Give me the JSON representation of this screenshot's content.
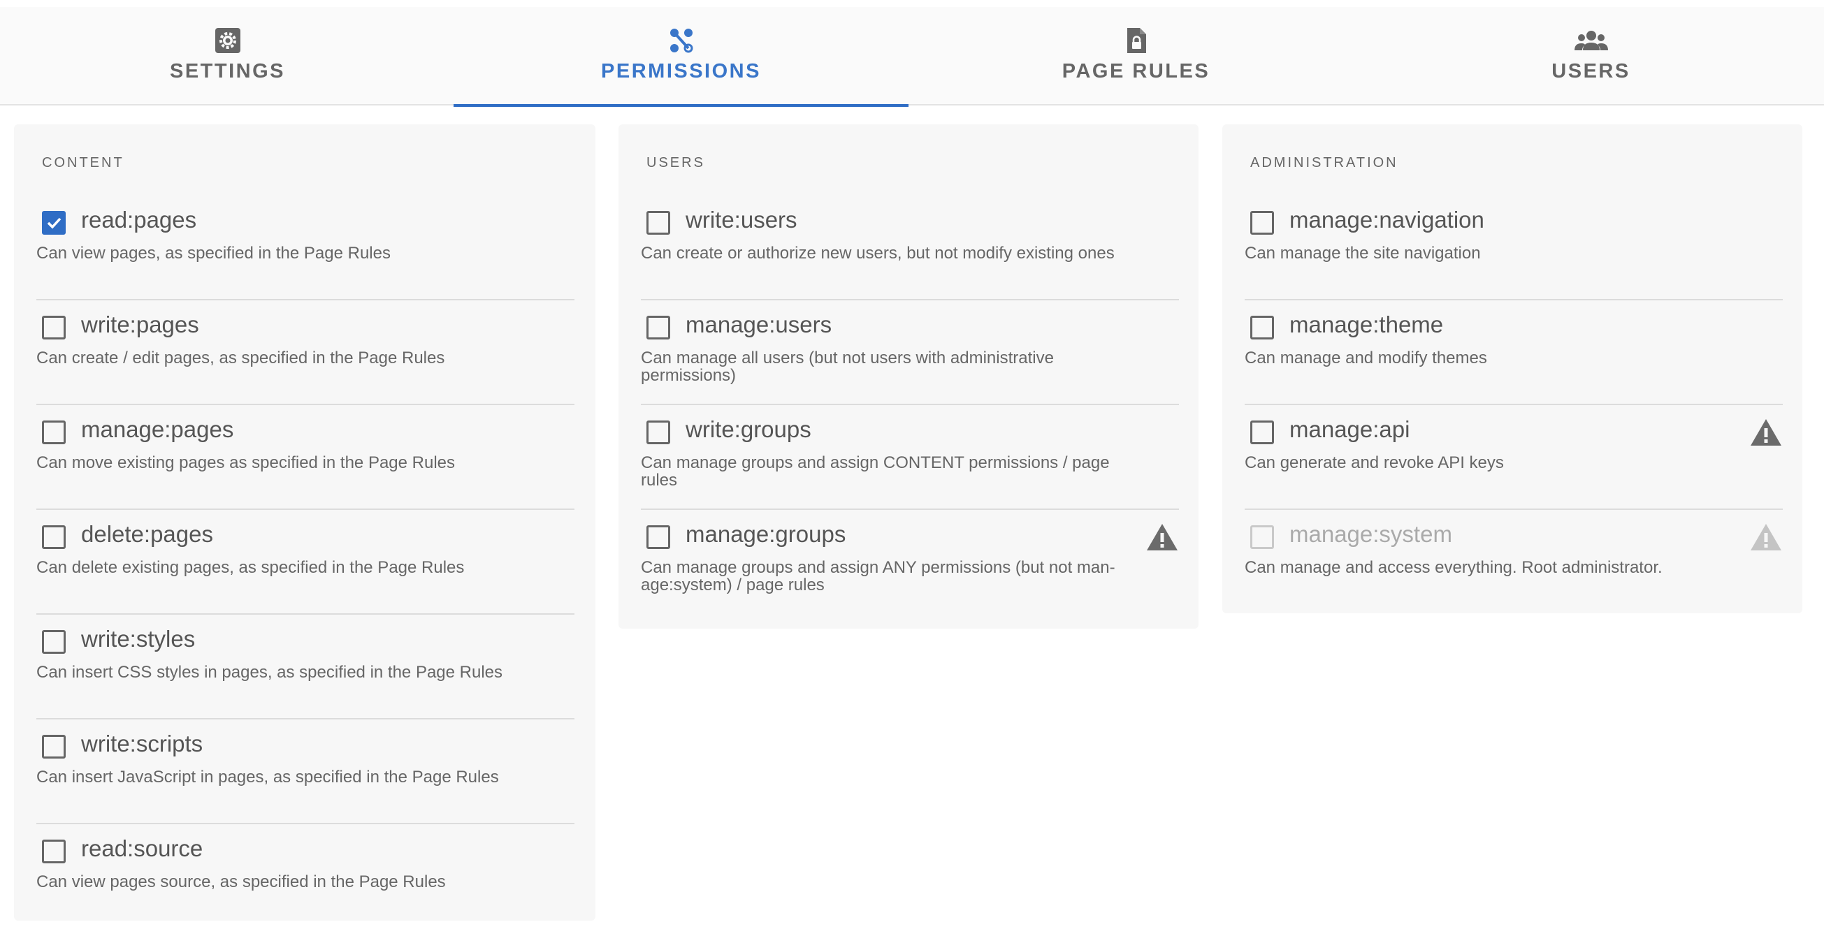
{
  "tabs": [
    {
      "label": "SETTINGS",
      "icon": "gear-icon",
      "active": false
    },
    {
      "label": "PERMISSIONS",
      "icon": "permissions-icon",
      "active": true
    },
    {
      "label": "PAGE RULES",
      "icon": "locked-file-icon",
      "active": false
    },
    {
      "label": "USERS",
      "icon": "users-icon",
      "active": false
    }
  ],
  "colors": {
    "accent": "#2f6dc5",
    "card_bg": "#f7f7f7",
    "warn": "#6b6b6b",
    "warn_disabled": "#c4c4c4"
  },
  "groups": [
    {
      "title": "CONTENT",
      "items": [
        {
          "name": "read:pages",
          "desc": "Can view pages, as specified in the Page Rules",
          "checked": true
        },
        {
          "name": "write:pages",
          "desc": "Can create / edit pages, as specified in the Page Rules",
          "checked": false
        },
        {
          "name": "manage:pages",
          "desc": "Can move existing pages as specified in the Page Rules",
          "checked": false
        },
        {
          "name": "delete:pages",
          "desc": "Can delete existing pages, as specified in the Page Rules",
          "checked": false
        },
        {
          "name": "write:styles",
          "desc": "Can insert CSS styles in pages, as specified in the Page Rules",
          "checked": false
        },
        {
          "name": "write:scripts",
          "desc": "Can insert JavaScript in pages, as specified in the Page Rules",
          "checked": false
        },
        {
          "name": "read:source",
          "desc": "Can view pages source, as specified in the Page Rules",
          "checked": false
        }
      ]
    },
    {
      "title": "USERS",
      "items": [
        {
          "name": "write:users",
          "desc": "Can create or authorize new users, but not modify existing ones",
          "checked": false
        },
        {
          "name": "manage:users",
          "desc": "Can manage all users (but not users with administrative permissions)",
          "checked": false
        },
        {
          "name": "write:groups",
          "desc": "Can manage groups and assign CONTENT permissions / page rules",
          "checked": false
        },
        {
          "name": "manage:groups",
          "desc_line1": "Can manage groups and assign ANY permissions (but not man-",
          "desc_line2": "age:system) / page rules",
          "checked": false,
          "warning": true
        }
      ]
    },
    {
      "title": "ADMINISTRATION",
      "items": [
        {
          "name": "manage:navigation",
          "desc": "Can manage the site navigation",
          "checked": false
        },
        {
          "name": "manage:theme",
          "desc": "Can manage and modify themes",
          "checked": false
        },
        {
          "name": "manage:api",
          "desc": "Can generate and revoke API keys",
          "checked": false,
          "warning": true
        },
        {
          "name": "manage:system",
          "desc": "Can manage and access everything. Root administrator.",
          "checked": false,
          "warning": true,
          "disabled": true
        }
      ]
    }
  ]
}
